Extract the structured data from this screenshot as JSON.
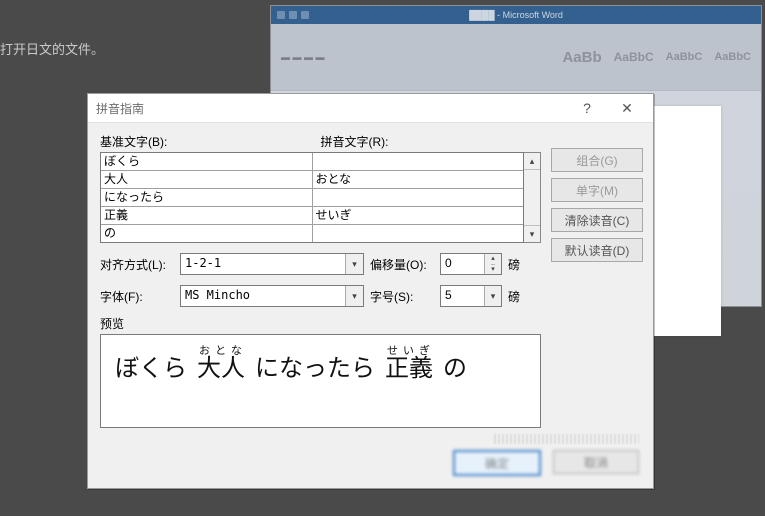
{
  "background": {
    "partial_text": "打开日文的文件。",
    "word_title_hint": "████ - Microsoft Word"
  },
  "dialog": {
    "title": "拼音指南",
    "help_icon": "?",
    "close_icon": "✕",
    "base_header": "基准文字(B):",
    "ruby_header": "拼音文字(R):",
    "rows": [
      {
        "base": "ぼくら",
        "ruby": ""
      },
      {
        "base": "大人",
        "ruby": "おとな"
      },
      {
        "base": "になったら",
        "ruby": ""
      },
      {
        "base": "正義",
        "ruby": "せいぎ"
      },
      {
        "base": "の",
        "ruby": ""
      }
    ],
    "side_buttons": {
      "combine": "组合(G)",
      "single": "单字(M)",
      "clear": "清除读音(C)",
      "default": "默认读音(D)"
    },
    "align": {
      "label": "对齐方式(L):",
      "value": "1-2-1"
    },
    "offset": {
      "label": "偏移量(O):",
      "value": "0",
      "unit": "磅"
    },
    "font": {
      "label": "字体(F):",
      "value": "MS Mincho"
    },
    "size": {
      "label": "字号(S):",
      "value": "5",
      "unit": "磅"
    },
    "preview_label": "预览",
    "preview": {
      "segments": [
        {
          "text": "ぼくら",
          "ruby": ""
        },
        {
          "text": "大人",
          "ruby": "おとな"
        },
        {
          "text": "になったら",
          "ruby": ""
        },
        {
          "text": "正義",
          "ruby": "せいぎ"
        },
        {
          "text": "の",
          "ruby": ""
        }
      ]
    },
    "footer": {
      "ok": "确定",
      "cancel": "取消"
    }
  }
}
